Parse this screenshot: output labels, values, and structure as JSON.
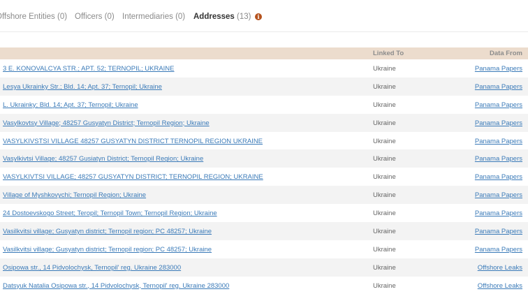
{
  "tabs": [
    {
      "label": "Offshore Entities",
      "count": "(0)"
    },
    {
      "label": "Officers",
      "count": "(0)"
    },
    {
      "label": "Intermediaries",
      "count": "(0)"
    },
    {
      "label": "Addresses",
      "count": "(13)"
    }
  ],
  "active_tab": "Addresses",
  "info_icon": {
    "glyph": "i",
    "color": "#b5521d"
  },
  "table": {
    "headers": {
      "address": "",
      "linked_to": "Linked To",
      "data_from": "Data From"
    },
    "rows": [
      {
        "address": "3 E. KONOVALCYA STR.; APT. 52; TERNOPIL; UKRAINE",
        "linked_to": "Ukraine",
        "data_from": "Panama Papers"
      },
      {
        "address": "Lesya Ukrainky Str.; Bld. 14; Apt. 37; Ternopil; Ukraine",
        "linked_to": "Ukraine",
        "data_from": "Panama Papers"
      },
      {
        "address": "L. Ukrainky; Bld. 14; Apt. 37; Ternopil; Ukraine",
        "linked_to": "Ukraine",
        "data_from": "Panama Papers"
      },
      {
        "address": "Vasylkovtsy Village; 48257 Gusyatyn District; Ternopil Region; Ukraine",
        "linked_to": "Ukraine",
        "data_from": "Panama Papers"
      },
      {
        "address": "VASYLKIVSTSI VILLAGE 48257 GUSYATYN DISTRICT TERNOPIL REGION UKRAINE",
        "linked_to": "Ukraine",
        "data_from": "Panama Papers"
      },
      {
        "address": "Vasylkivtsi Village; 48257 Gusiatyn District; Ternopil Region; Ukraine",
        "linked_to": "Ukraine",
        "data_from": "Panama Papers"
      },
      {
        "address": "VASYLKIVTSI VILLAGE; 48257 GUSYATYN DISTRICT; TERNOPIL REGION; UKRAINE",
        "linked_to": "Ukraine",
        "data_from": "Panama Papers"
      },
      {
        "address": "Village of Myshkovychi; Ternopil Region; Ukraine",
        "linked_to": "Ukraine",
        "data_from": "Panama Papers"
      },
      {
        "address": "24 Dostoevskogo Street; Teropil; Ternopil Town; Ternopil Region; Ukraine",
        "linked_to": "Ukraine",
        "data_from": "Panama Papers"
      },
      {
        "address": "Vasilkvitsi village; Gusyatyn district; Ternopil region; PC 48257; Ukraine",
        "linked_to": "Ukraine",
        "data_from": "Panama Papers"
      },
      {
        "address": "Vasilkvitsi village; Gusyatyn district; Ternopil region; PC 48257; Ukraine",
        "linked_to": "Ukraine",
        "data_from": "Panama Papers"
      },
      {
        "address": "Osipowa str., 14 Pidvolochysk, Ternopil' reg. Ukraine 283000",
        "linked_to": "Ukraine",
        "data_from": "Offshore Leaks"
      },
      {
        "address": "Datsyuk Natalia Osipowa str., 14 Pidvolochysk, Ternopil' reg. Ukraine 283000",
        "linked_to": "Ukraine",
        "data_from": "Offshore Leaks"
      }
    ]
  }
}
